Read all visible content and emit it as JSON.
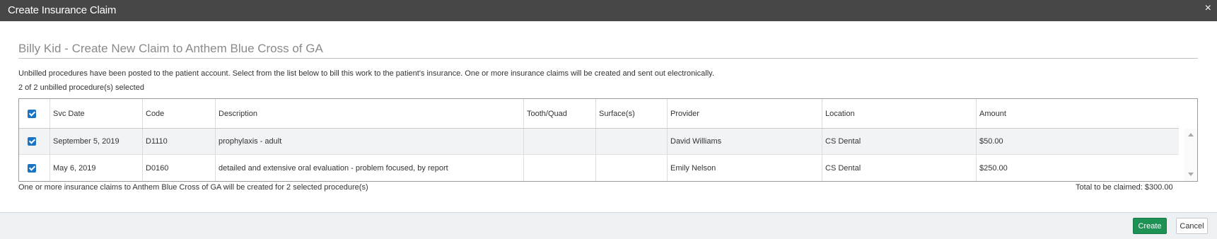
{
  "window": {
    "title": "Create Insurance Claim",
    "close_glyph": "×",
    "close_icon": "close-icon"
  },
  "dialog": {
    "heading": "Billy Kid - Create New Claim to Anthem Blue Cross of GA",
    "intro": "Unbilled procedures have been posted to the patient account. Select from the list below to bill this work to the patient's insurance. One or more insurance claims will be created and sent out electronically.",
    "selected_count": "2 of 2 unbilled procedure(s) selected"
  },
  "table": {
    "select_all_checked": true,
    "columns": [
      "Svc Date",
      "Code",
      "Description",
      "Tooth/Quad",
      "Surface(s)",
      "Provider",
      "Location",
      "Amount"
    ],
    "rows": [
      {
        "checked": true,
        "svc_date": "September 5, 2019",
        "code": "D1110",
        "description": "prophylaxis - adult",
        "tooth_quad": "",
        "surfaces": "",
        "provider": "David Williams",
        "location": "CS Dental",
        "amount": "$50.00"
      },
      {
        "checked": true,
        "svc_date": "May 6, 2019",
        "code": "D0160",
        "description": "detailed and extensive oral evaluation - problem focused, by report",
        "tooth_quad": "",
        "surfaces": "",
        "provider": "Emily Nelson",
        "location": "CS Dental",
        "amount": "$250.00"
      }
    ]
  },
  "footer": {
    "note": "One or more insurance claims to Anthem Blue Cross of GA will be created for 2 selected procedure(s)",
    "total": "Total to be claimed: $300.00"
  },
  "actions": {
    "create_label": "Create",
    "cancel_label": "Cancel"
  },
  "colors": {
    "titlebar": "#474747",
    "checkbox": "#1a74c6",
    "create_button": "#1e9155",
    "row_highlight": "#f1f3f5"
  }
}
